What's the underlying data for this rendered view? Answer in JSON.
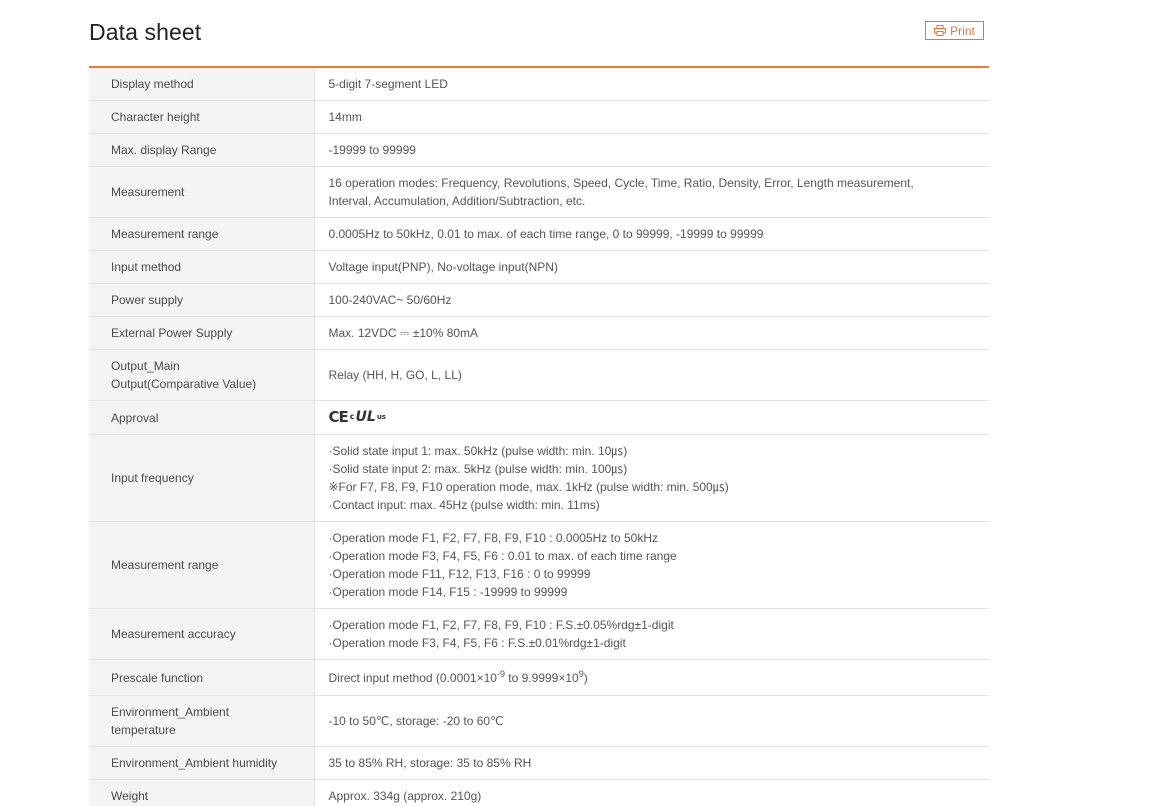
{
  "header": {
    "title": "Data sheet",
    "print_label": "Print"
  },
  "rows": [
    {
      "label": [
        "Display method"
      ],
      "value": [
        "5-digit 7-segment LED"
      ]
    },
    {
      "label": [
        "Character height"
      ],
      "value": [
        "14mm"
      ]
    },
    {
      "label": [
        "Max. display Range"
      ],
      "value": [
        "-19999 to 99999"
      ]
    },
    {
      "label": [
        "Measurement"
      ],
      "value": [
        "16 operation modes: Frequency, Revolutions, Speed, Cycle, Time, Ratio, Density, Error, Length measurement,",
        "Interval, Accumulation, Addition/Subtraction, etc."
      ]
    },
    {
      "label": [
        "Measurement range"
      ],
      "value": [
        "0.0005Hz to 50kHz, 0.01 to max. of each time range, 0 to 99999, -19999 to 99999"
      ]
    },
    {
      "label": [
        "Input method"
      ],
      "value": [
        "Voltage input(PNP), No-voltage input(NPN)"
      ]
    },
    {
      "label": [
        "Power supply"
      ],
      "value": [
        "100-240VAC~ 50/60Hz"
      ]
    },
    {
      "label": [
        "External Power Supply"
      ],
      "value": [
        "Max. 12VDC ⎓ ±10% 80mA"
      ]
    },
    {
      "label": [
        "Output_Main",
        "Output(Comparative Value)"
      ],
      "value": [
        "Relay (HH, H, GO, L, LL)"
      ]
    },
    {
      "label": [
        "Approval"
      ],
      "value": [],
      "cert": {
        "ce": "CE",
        "c": "c",
        "ul": "UL",
        "us": "us"
      }
    },
    {
      "label": [
        "Input frequency"
      ],
      "value": [
        "·Solid state input 1: max. 50kHz (pulse width: min. 10㎲)",
        "·Solid state input 2: max. 5kHz (pulse width: min. 100㎲)",
        "※For F7, F8, F9, F10 operation mode, max. 1kHz (pulse width: min. 500㎲)",
        "·Contact input: max. 45Hz (pulse width: min. 11ms)"
      ]
    },
    {
      "label": [
        "Measurement range"
      ],
      "value": [
        "·Operation mode F1, F2, F7, F8, F9, F10 : 0.0005Hz to 50kHz",
        "·Operation mode F3, F4, F5, F6 : 0.01 to max. of each time range",
        "·Operation mode F11, F12, F13, F16 : 0 to 99999",
        "·Operation mode F14, F15 : -19999 to 99999"
      ]
    },
    {
      "label": [
        "Measurement accuracy"
      ],
      "value": [
        "·Operation mode F1, F2, F7, F8, F9, F10 : F.S.±0.05%rdg±1-digit",
        "·Operation mode F3, F4, F5, F6 : F.S.±0.01%rdg±1-digit"
      ]
    },
    {
      "label": [
        "Prescale function"
      ],
      "value": [],
      "prescale": {
        "prefix": "Direct input method (0.0001×10",
        "exp1": "-9",
        "mid": " to 9.9999×10",
        "exp2": "9",
        "suffix": ")"
      }
    },
    {
      "label": [
        "Environment_Ambient",
        "temperature"
      ],
      "value": [
        "-10 to 50℃, storage: -20 to 60℃"
      ]
    },
    {
      "label": [
        "Environment_Ambient humidity"
      ],
      "value": [
        "35 to 85% RH, storage: 35 to 85% RH"
      ]
    },
    {
      "label": [
        "Weight"
      ],
      "value": [
        "Approx. 334g (approx. 210g)"
      ]
    }
  ],
  "colors": {
    "accent": "#ea7c34",
    "label_bg": "#f4f4f4",
    "border": "#e2e2e2"
  },
  "icons": {
    "print": "printer-icon"
  }
}
